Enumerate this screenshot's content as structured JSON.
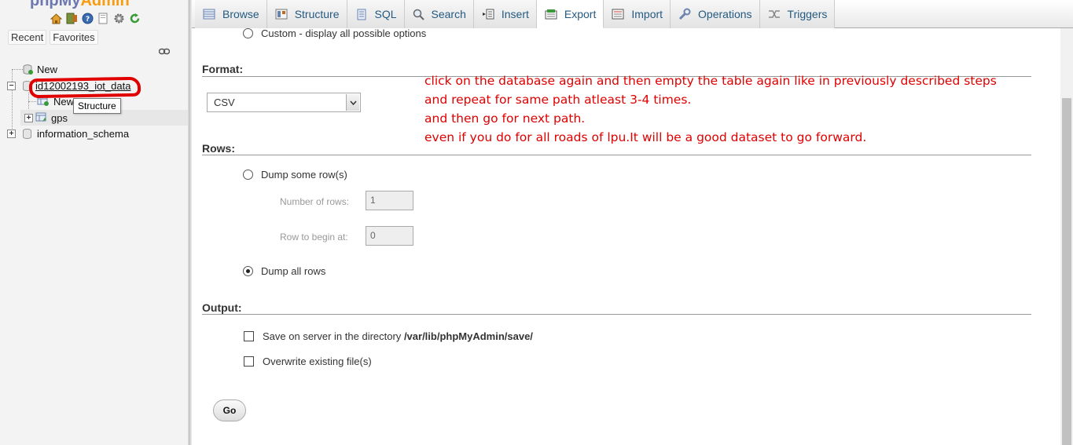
{
  "app": {
    "logo_part1": "phpMy",
    "logo_part2": "Admin"
  },
  "sidebar": {
    "recent_label": "Recent",
    "favorites_label": "Favorites",
    "tree": {
      "new_root": "New",
      "db_selected": "id12002193_iot_data",
      "db_new": "New",
      "table_gps": "gps",
      "db_info_schema": "information_schema"
    },
    "tooltip": "Structure"
  },
  "tabs": [
    {
      "label": "Browse",
      "icon": "browse-icon"
    },
    {
      "label": "Structure",
      "icon": "structure-icon"
    },
    {
      "label": "SQL",
      "icon": "sql-icon"
    },
    {
      "label": "Search",
      "icon": "search-icon"
    },
    {
      "label": "Insert",
      "icon": "insert-icon"
    },
    {
      "label": "Export",
      "icon": "export-icon",
      "active": true
    },
    {
      "label": "Import",
      "icon": "import-icon"
    },
    {
      "label": "Operations",
      "icon": "operations-icon"
    },
    {
      "label": "Triggers",
      "icon": "triggers-icon"
    }
  ],
  "export": {
    "custom_option": "Custom - display all possible options",
    "format_heading": "Format:",
    "format_value": "CSV",
    "rows_heading": "Rows:",
    "dump_some_rows": "Dump some row(s)",
    "number_of_rows_label": "Number of rows:",
    "number_of_rows_value": "1",
    "row_to_begin_label": "Row to begin at:",
    "row_to_begin_value": "0",
    "dump_all_rows": "Dump all rows",
    "output_heading": "Output:",
    "save_on_server_prefix": "Save on server in the directory",
    "save_on_server_path": "/var/lib/phpMyAdmin/save/",
    "overwrite_files": "Overwrite existing file(s)",
    "go_label": "Go"
  },
  "annotation": {
    "line1": "click on the database again and then empty the table again like in previously described steps",
    "line2": "and repeat for same path atleast 3-4 times.",
    "line3": "and then go for next path.",
    "line4": "even if you do for all roads of lpu.It will be a good dataset to go forward."
  },
  "colors": {
    "tab_text": "#235a81",
    "annotation_red": "#e00000",
    "sidebar_bg": "#f3f3f3"
  }
}
